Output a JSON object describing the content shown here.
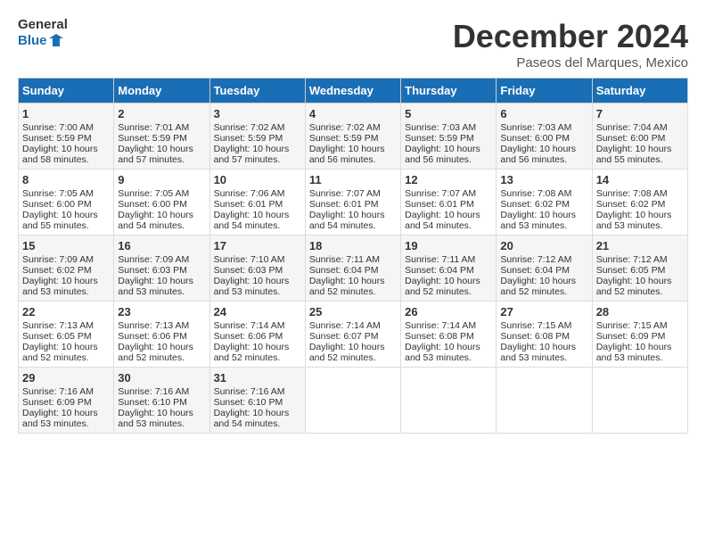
{
  "logo": {
    "line1": "General",
    "line2": "Blue"
  },
  "title": "December 2024",
  "location": "Paseos del Marques, Mexico",
  "days_of_week": [
    "Sunday",
    "Monday",
    "Tuesday",
    "Wednesday",
    "Thursday",
    "Friday",
    "Saturday"
  ],
  "weeks": [
    [
      {
        "day": 1,
        "sunrise": "7:00 AM",
        "sunset": "5:59 PM",
        "daylight": "10 hours and 58 minutes."
      },
      {
        "day": 2,
        "sunrise": "7:01 AM",
        "sunset": "5:59 PM",
        "daylight": "10 hours and 57 minutes."
      },
      {
        "day": 3,
        "sunrise": "7:02 AM",
        "sunset": "5:59 PM",
        "daylight": "10 hours and 57 minutes."
      },
      {
        "day": 4,
        "sunrise": "7:02 AM",
        "sunset": "5:59 PM",
        "daylight": "10 hours and 56 minutes."
      },
      {
        "day": 5,
        "sunrise": "7:03 AM",
        "sunset": "5:59 PM",
        "daylight": "10 hours and 56 minutes."
      },
      {
        "day": 6,
        "sunrise": "7:03 AM",
        "sunset": "6:00 PM",
        "daylight": "10 hours and 56 minutes."
      },
      {
        "day": 7,
        "sunrise": "7:04 AM",
        "sunset": "6:00 PM",
        "daylight": "10 hours and 55 minutes."
      }
    ],
    [
      {
        "day": 8,
        "sunrise": "7:05 AM",
        "sunset": "6:00 PM",
        "daylight": "10 hours and 55 minutes."
      },
      {
        "day": 9,
        "sunrise": "7:05 AM",
        "sunset": "6:00 PM",
        "daylight": "10 hours and 54 minutes."
      },
      {
        "day": 10,
        "sunrise": "7:06 AM",
        "sunset": "6:01 PM",
        "daylight": "10 hours and 54 minutes."
      },
      {
        "day": 11,
        "sunrise": "7:07 AM",
        "sunset": "6:01 PM",
        "daylight": "10 hours and 54 minutes."
      },
      {
        "day": 12,
        "sunrise": "7:07 AM",
        "sunset": "6:01 PM",
        "daylight": "10 hours and 54 minutes."
      },
      {
        "day": 13,
        "sunrise": "7:08 AM",
        "sunset": "6:02 PM",
        "daylight": "10 hours and 53 minutes."
      },
      {
        "day": 14,
        "sunrise": "7:08 AM",
        "sunset": "6:02 PM",
        "daylight": "10 hours and 53 minutes."
      }
    ],
    [
      {
        "day": 15,
        "sunrise": "7:09 AM",
        "sunset": "6:02 PM",
        "daylight": "10 hours and 53 minutes."
      },
      {
        "day": 16,
        "sunrise": "7:09 AM",
        "sunset": "6:03 PM",
        "daylight": "10 hours and 53 minutes."
      },
      {
        "day": 17,
        "sunrise": "7:10 AM",
        "sunset": "6:03 PM",
        "daylight": "10 hours and 53 minutes."
      },
      {
        "day": 18,
        "sunrise": "7:11 AM",
        "sunset": "6:04 PM",
        "daylight": "10 hours and 52 minutes."
      },
      {
        "day": 19,
        "sunrise": "7:11 AM",
        "sunset": "6:04 PM",
        "daylight": "10 hours and 52 minutes."
      },
      {
        "day": 20,
        "sunrise": "7:12 AM",
        "sunset": "6:04 PM",
        "daylight": "10 hours and 52 minutes."
      },
      {
        "day": 21,
        "sunrise": "7:12 AM",
        "sunset": "6:05 PM",
        "daylight": "10 hours and 52 minutes."
      }
    ],
    [
      {
        "day": 22,
        "sunrise": "7:13 AM",
        "sunset": "6:05 PM",
        "daylight": "10 hours and 52 minutes."
      },
      {
        "day": 23,
        "sunrise": "7:13 AM",
        "sunset": "6:06 PM",
        "daylight": "10 hours and 52 minutes."
      },
      {
        "day": 24,
        "sunrise": "7:14 AM",
        "sunset": "6:06 PM",
        "daylight": "10 hours and 52 minutes."
      },
      {
        "day": 25,
        "sunrise": "7:14 AM",
        "sunset": "6:07 PM",
        "daylight": "10 hours and 52 minutes."
      },
      {
        "day": 26,
        "sunrise": "7:14 AM",
        "sunset": "6:08 PM",
        "daylight": "10 hours and 53 minutes."
      },
      {
        "day": 27,
        "sunrise": "7:15 AM",
        "sunset": "6:08 PM",
        "daylight": "10 hours and 53 minutes."
      },
      {
        "day": 28,
        "sunrise": "7:15 AM",
        "sunset": "6:09 PM",
        "daylight": "10 hours and 53 minutes."
      }
    ],
    [
      {
        "day": 29,
        "sunrise": "7:16 AM",
        "sunset": "6:09 PM",
        "daylight": "10 hours and 53 minutes."
      },
      {
        "day": 30,
        "sunrise": "7:16 AM",
        "sunset": "6:10 PM",
        "daylight": "10 hours and 53 minutes."
      },
      {
        "day": 31,
        "sunrise": "7:16 AM",
        "sunset": "6:10 PM",
        "daylight": "10 hours and 54 minutes."
      },
      null,
      null,
      null,
      null
    ]
  ]
}
